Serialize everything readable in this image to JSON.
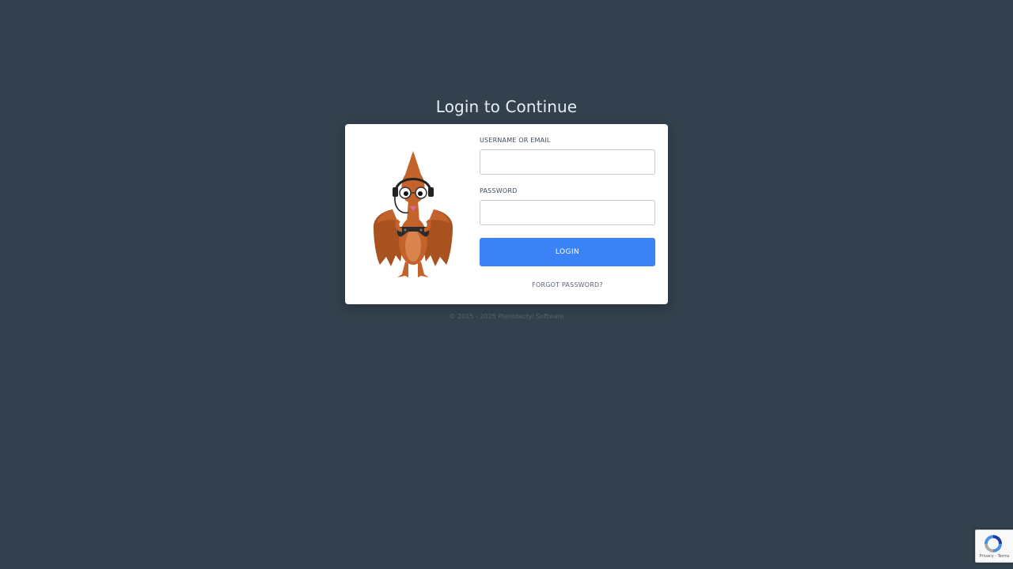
{
  "page": {
    "title": "Login to Continue",
    "footer": "© 2015 - 2025 Pterodactyl Software"
  },
  "form": {
    "username_label": "USERNAME OR EMAIL",
    "username_value": "",
    "password_label": "PASSWORD",
    "password_value": "",
    "login_button": "LOGIN",
    "forgot_link": "FORGOT PASSWORD?"
  },
  "recaptcha": {
    "terms_text": "Privacy - Terms"
  },
  "colors": {
    "background": "#33404d",
    "card": "#ffffff",
    "primary_button": "#3b82f6",
    "mascot": "#c4622b"
  },
  "icons": {
    "mascot": "pterodactyl-gamer-mascot",
    "recaptcha": "recaptcha-icon"
  }
}
